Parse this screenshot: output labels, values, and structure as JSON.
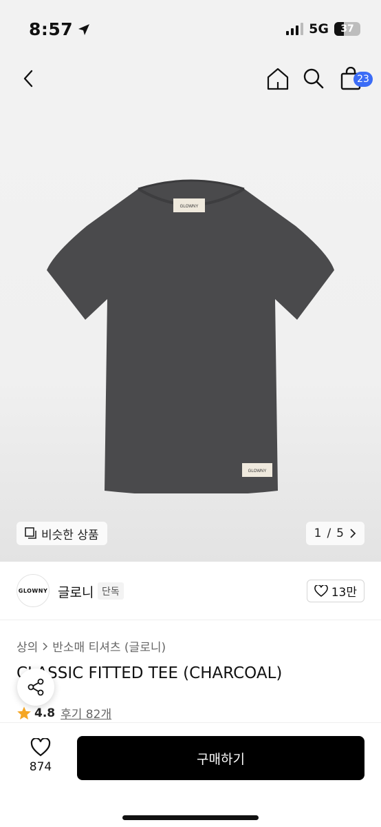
{
  "status": {
    "time": "8:57",
    "network": "5G",
    "battery": "37",
    "battery_level": 0.37,
    "signal_bars": 4,
    "signal_active": 3
  },
  "header": {
    "cart_count": "23"
  },
  "image": {
    "similar_label": "비슷한 상품",
    "page_current": "1",
    "page_separator": "/",
    "page_total": "5",
    "tag_text": "GLOWNY"
  },
  "brand": {
    "logo_text": "GLOWNY",
    "name": "글로니",
    "tag": "단독",
    "likes": "13만"
  },
  "breadcrumb": {
    "items": [
      "상의",
      "반소매 티셔츠 (글로니)"
    ]
  },
  "product": {
    "title": "CLASSIC FITTED TEE (CHARCOAL)",
    "rating": "4.8",
    "reviews": "후기 82개"
  },
  "bottom": {
    "wish_count": "874",
    "buy_label": "구매하기"
  },
  "colors": {
    "accent": "#3b6cf6",
    "shirt": "#4a4a4c",
    "star": "#f5a623",
    "buy_button": "#000000"
  }
}
